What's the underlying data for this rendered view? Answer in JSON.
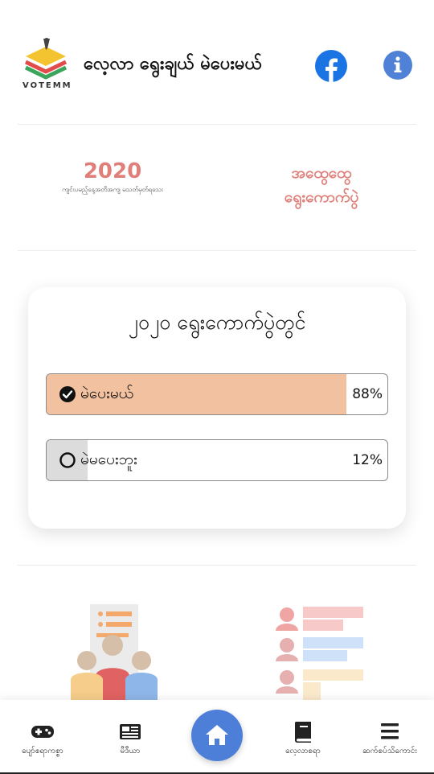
{
  "header": {
    "logo_text": "VOTEMM",
    "title": "လေ့လာ ရွေးချယ် မဲပေးမယ်",
    "facebook_icon": "facebook-icon",
    "info_icon": "info-icon"
  },
  "quick_links": {
    "year_title": "2020",
    "year_subtitle": "ကျင်းပမည့်နေ့အတိအကျ မသတ်မှတ်ရသေး",
    "general_line1": "အထွေထွေ",
    "general_line2": "ရွေးကောက်ပွဲ"
  },
  "poll": {
    "title": "၂၀၂၀ ရွေးကောက်ပွဲတွင်",
    "options": [
      {
        "label": "မဲပေးမယ်",
        "percent_text": "88%",
        "percent": 88,
        "selected": true
      },
      {
        "label": "မဲမပေးဘူး",
        "percent_text": "12%",
        "percent": 12,
        "selected": false
      }
    ]
  },
  "nav": {
    "items": [
      {
        "label": "ပျော်စရာကစ္စာ",
        "icon": "gamepad-icon"
      },
      {
        "label": "မီဒီယာ",
        "icon": "newspaper-icon"
      },
      {
        "label": "",
        "icon": "home-icon"
      },
      {
        "label": "လေ့လာစရာ",
        "icon": "book-icon"
      },
      {
        "label": "ဆက်စပ်သိကောင်း",
        "icon": "menu-icon"
      }
    ]
  },
  "colors": {
    "accent_blue": "#4d7fd8",
    "facebook_blue": "#1b74e4",
    "salmon": "#e07f79",
    "poll_fill": "#f2c19f"
  }
}
